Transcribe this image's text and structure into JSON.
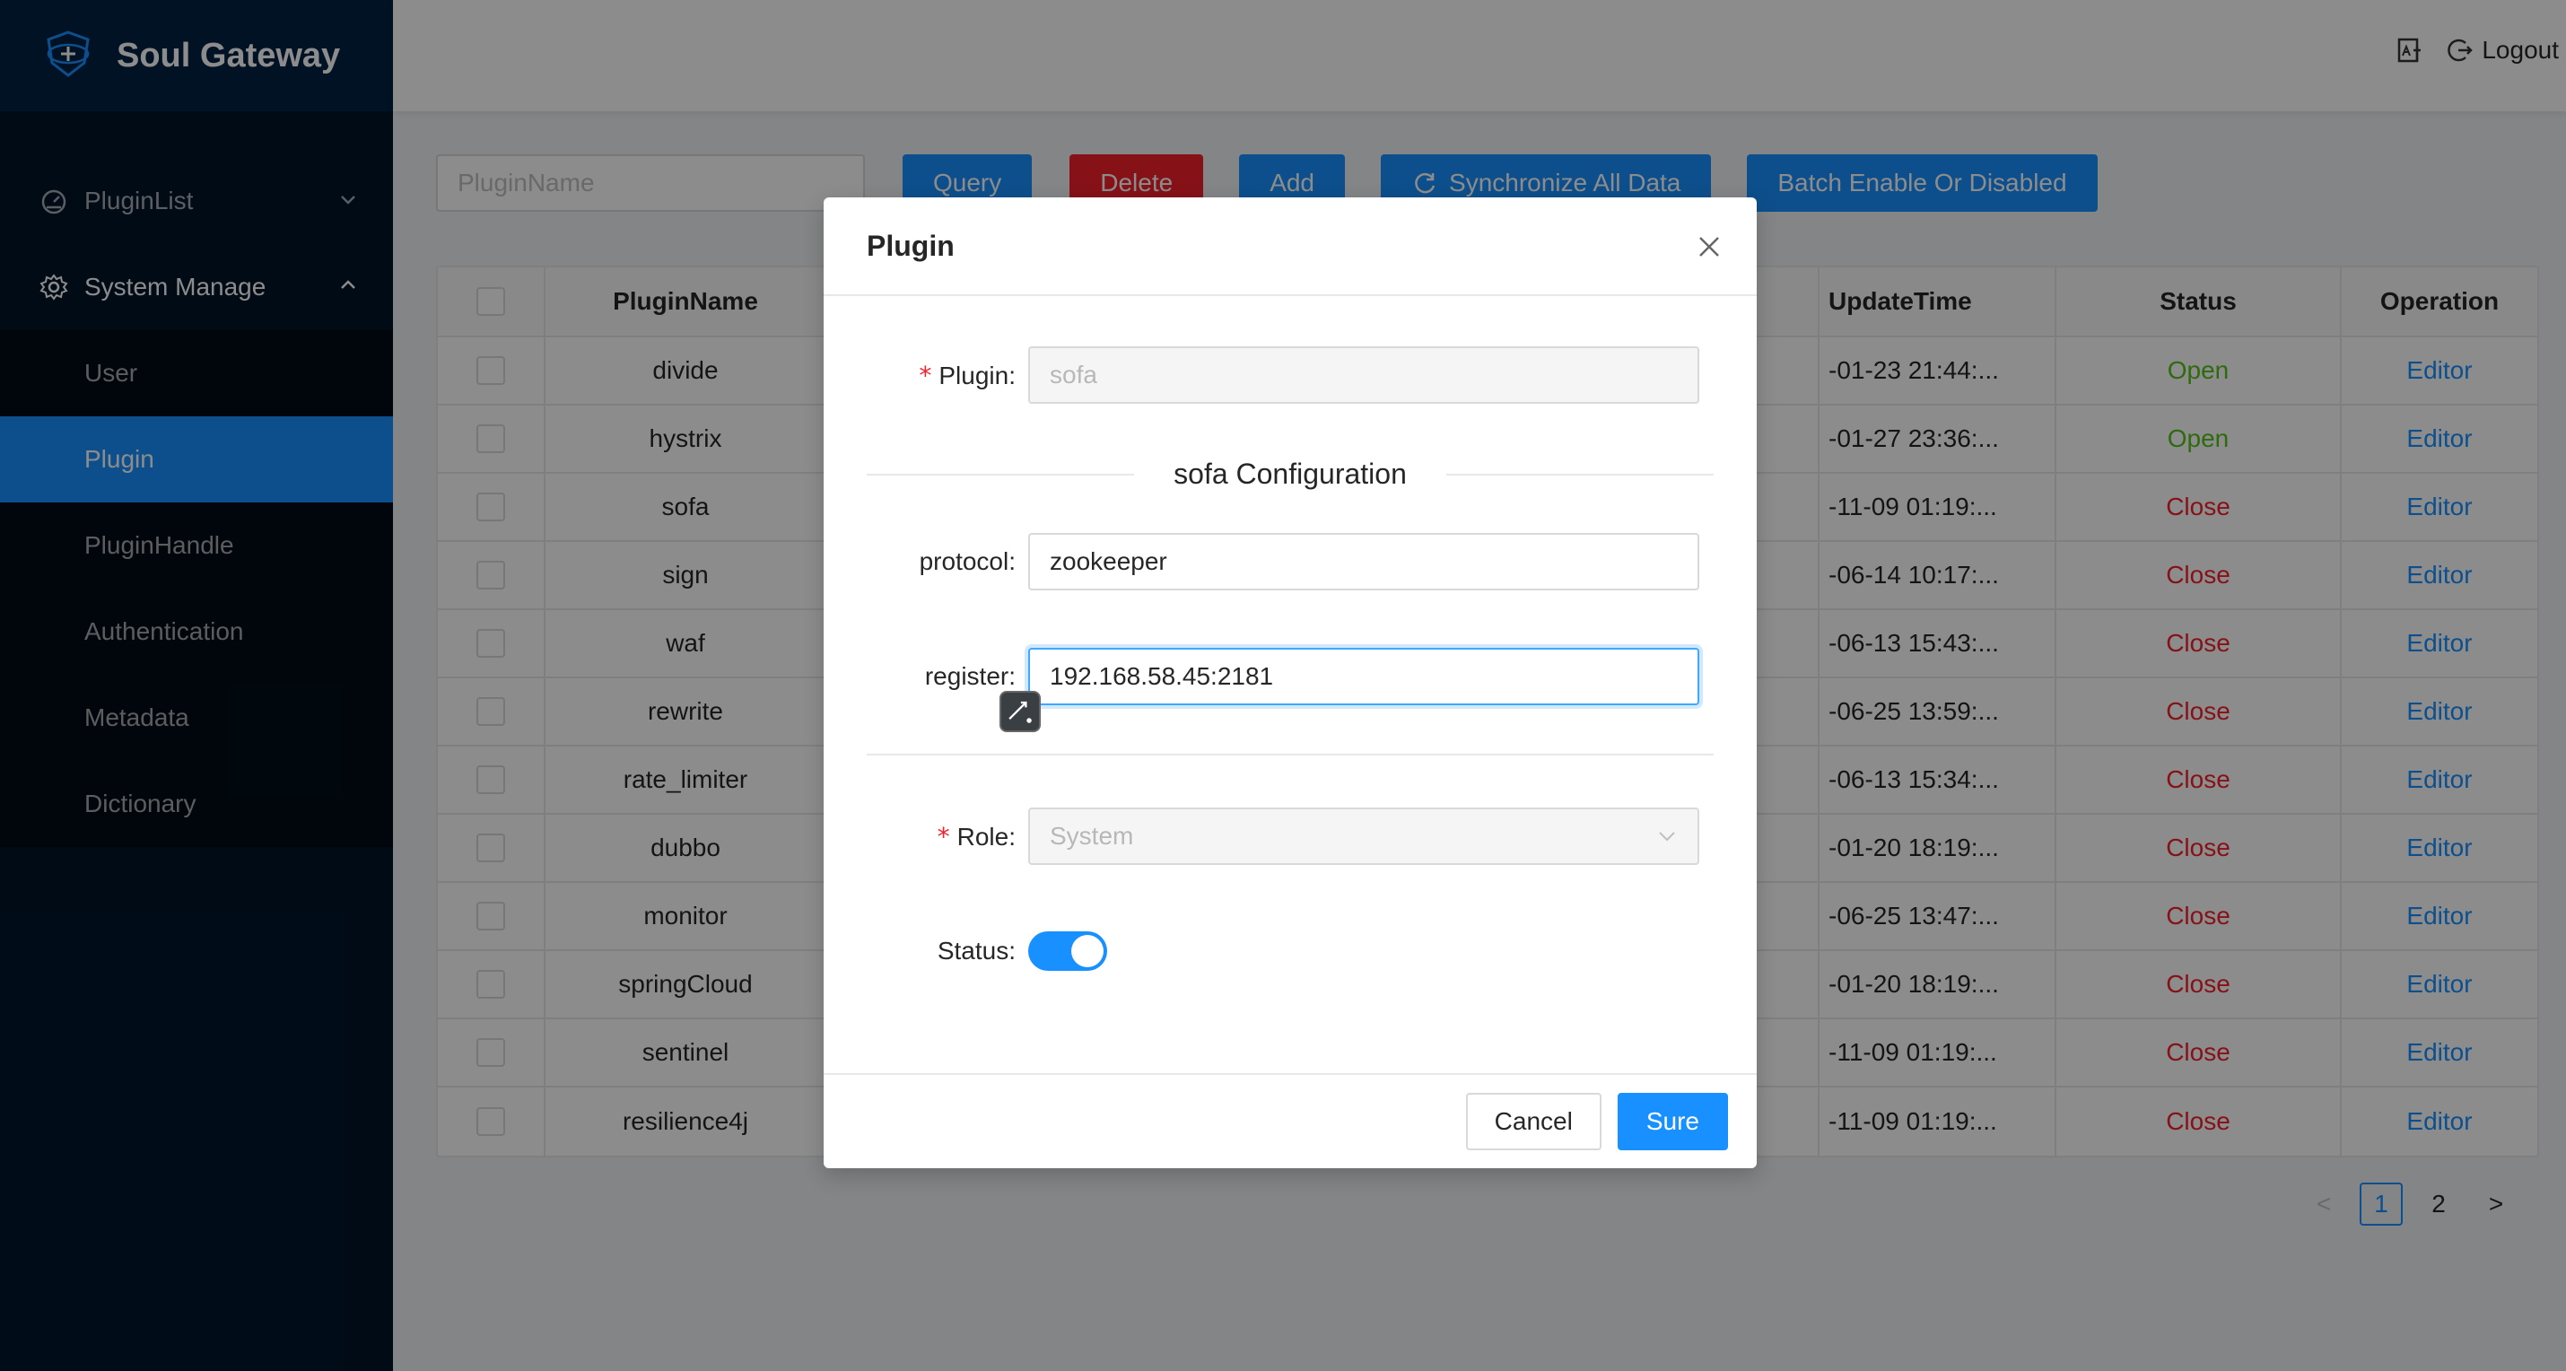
{
  "app": {
    "title": "Soul Gateway"
  },
  "header": {
    "logout_label": "Logout",
    "lang_icon": "translate-icon",
    "logout_icon": "logout-icon"
  },
  "sidebar": {
    "menus": [
      {
        "label": "PluginList",
        "icon": "dashboard-icon",
        "expanded": false
      },
      {
        "label": "System Manage",
        "icon": "gear-icon",
        "expanded": true
      }
    ],
    "sub_items": [
      {
        "label": "User",
        "active": false
      },
      {
        "label": "Plugin",
        "active": true
      },
      {
        "label": "PluginHandle",
        "active": false
      },
      {
        "label": "Authentication",
        "active": false
      },
      {
        "label": "Metadata",
        "active": false
      },
      {
        "label": "Dictionary",
        "active": false
      }
    ]
  },
  "toolbar": {
    "search_placeholder": "PluginName",
    "query_label": "Query",
    "delete_label": "Delete",
    "add_label": "Add",
    "sync_label": "Synchronize All Data",
    "batch_label": "Batch Enable Or Disabled"
  },
  "table": {
    "columns": {
      "name": "PluginName",
      "update_time": "UpdateTime",
      "status": "Status",
      "operation": "Operation"
    },
    "rows": [
      {
        "name": "divide",
        "update_time": "-01-23 21:44:...",
        "status": "Open",
        "op": "Editor"
      },
      {
        "name": "hystrix",
        "update_time": "-01-27 23:36:...",
        "status": "Open",
        "op": "Editor"
      },
      {
        "name": "sofa",
        "update_time": "-11-09 01:19:...",
        "status": "Close",
        "op": "Editor"
      },
      {
        "name": "sign",
        "update_time": "-06-14 10:17:...",
        "status": "Close",
        "op": "Editor"
      },
      {
        "name": "waf",
        "update_time": "-06-13 15:43:...",
        "status": "Close",
        "op": "Editor"
      },
      {
        "name": "rewrite",
        "update_time": "-06-25 13:59:...",
        "status": "Close",
        "op": "Editor"
      },
      {
        "name": "rate_limiter",
        "update_time": "-06-13 15:34:...",
        "status": "Close",
        "op": "Editor"
      },
      {
        "name": "dubbo",
        "update_time": "-01-20 18:19:...",
        "status": "Close",
        "op": "Editor"
      },
      {
        "name": "monitor",
        "update_time": "-06-25 13:47:...",
        "status": "Close",
        "op": "Editor"
      },
      {
        "name": "springCloud",
        "update_time": "-01-20 18:19:...",
        "status": "Close",
        "op": "Editor"
      },
      {
        "name": "sentinel",
        "update_time": "-11-09 01:19:...",
        "status": "Close",
        "op": "Editor"
      },
      {
        "name": "resilience4j",
        "update_time": "-11-09 01:19:...",
        "status": "Close",
        "op": "Editor"
      }
    ]
  },
  "pagination": {
    "prev": "<",
    "pages": [
      "1",
      "2"
    ],
    "current": "1",
    "next": ">"
  },
  "modal": {
    "title": "Plugin",
    "plugin_label": "Plugin",
    "plugin_value": "sofa",
    "section_title": "sofa Configuration",
    "protocol_label": "protocol",
    "protocol_value": "zookeeper",
    "register_label": "register",
    "register_value": "192.168.58.45:2181",
    "role_label": "Role",
    "role_value": "System",
    "status_label": "Status",
    "status_on": true,
    "cancel_label": "Cancel",
    "sure_label": "Sure",
    "colon": ":"
  },
  "colors": {
    "primary": "#1890ff",
    "danger": "#f5222d",
    "success": "#52c41a",
    "sidebar_bg": "#001529"
  }
}
